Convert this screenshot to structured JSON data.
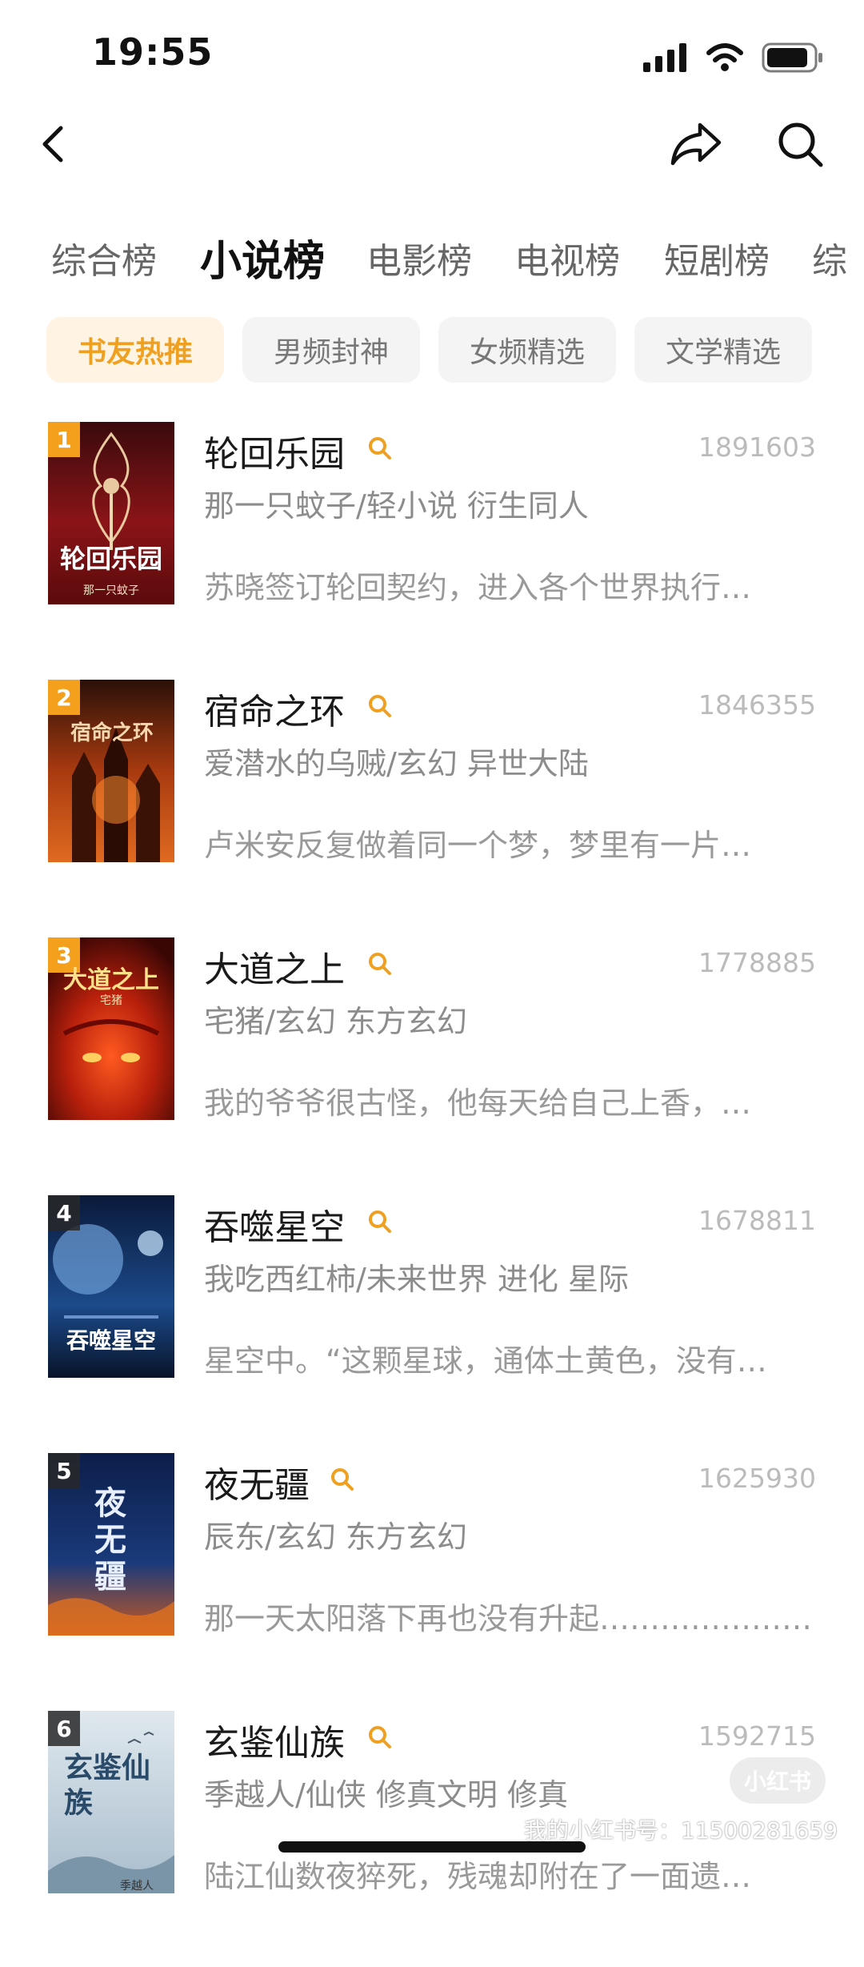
{
  "status_bar": {
    "time": "19:55"
  },
  "category_tabs": [
    {
      "label": "综合榜",
      "active": false
    },
    {
      "label": "小说榜",
      "active": true
    },
    {
      "label": "电影榜",
      "active": false
    },
    {
      "label": "电视榜",
      "active": false
    },
    {
      "label": "短剧榜",
      "active": false
    },
    {
      "label": "综",
      "active": false
    }
  ],
  "filter_chips": [
    {
      "label": "书友热推",
      "active": true
    },
    {
      "label": "男频封神",
      "active": false
    },
    {
      "label": "女频精选",
      "active": false
    },
    {
      "label": "文学精选",
      "active": false
    }
  ],
  "books": [
    {
      "rank": "1",
      "title": "轮回乐园",
      "score": "1891603",
      "meta": "那一只蚊子/轻小说 衍生同人",
      "desc": "苏晓签订轮回契约，进入各个世界执行…",
      "cover_text": "轮回乐园",
      "cover_author": "那一只蚊子"
    },
    {
      "rank": "2",
      "title": "宿命之环",
      "score": "1846355",
      "meta": "爱潜水的乌贼/玄幻 异世大陆",
      "desc": "卢米安反复做着同一个梦，梦里有一片…",
      "cover_text": "宿命之环",
      "cover_author": ""
    },
    {
      "rank": "3",
      "title": "大道之上",
      "score": "1778885",
      "meta": "宅猪/玄幻 东方玄幻",
      "desc": "我的爷爷很古怪，他每天给自己上香，…",
      "cover_text": "大道之上",
      "cover_author": "宅猪"
    },
    {
      "rank": "4",
      "title": "吞噬星空",
      "score": "1678811",
      "meta": "我吃西红柿/未来世界 进化 星际",
      "desc": "星空中。“这颗星球，通体土黄色，没有…",
      "cover_text": "吞噬星空",
      "cover_author": ""
    },
    {
      "rank": "5",
      "title": "夜无疆",
      "score": "1625930",
      "meta": "辰东/玄幻 东方玄幻",
      "desc": "那一天太阳落下再也没有升起…………………",
      "cover_text": "夜无疆",
      "cover_author": ""
    },
    {
      "rank": "6",
      "title": "玄鉴仙族",
      "score": "1592715",
      "meta": "季越人/仙侠 修真文明 修真",
      "desc": "陆江仙数夜猝死，残魂却附在了一面遗…",
      "cover_text": "玄鉴仙族",
      "cover_author": "季越人"
    }
  ],
  "watermark": {
    "logo": "小红书",
    "id": "我的小红书号：11500281659"
  },
  "colors": {
    "accent": "#f0a020",
    "chip_active_bg": "#fff4e3",
    "rank_top": "#f4a01c"
  },
  "icons": {
    "back": "chevron-left-icon",
    "share": "share-arrow-icon",
    "search": "search-icon"
  }
}
